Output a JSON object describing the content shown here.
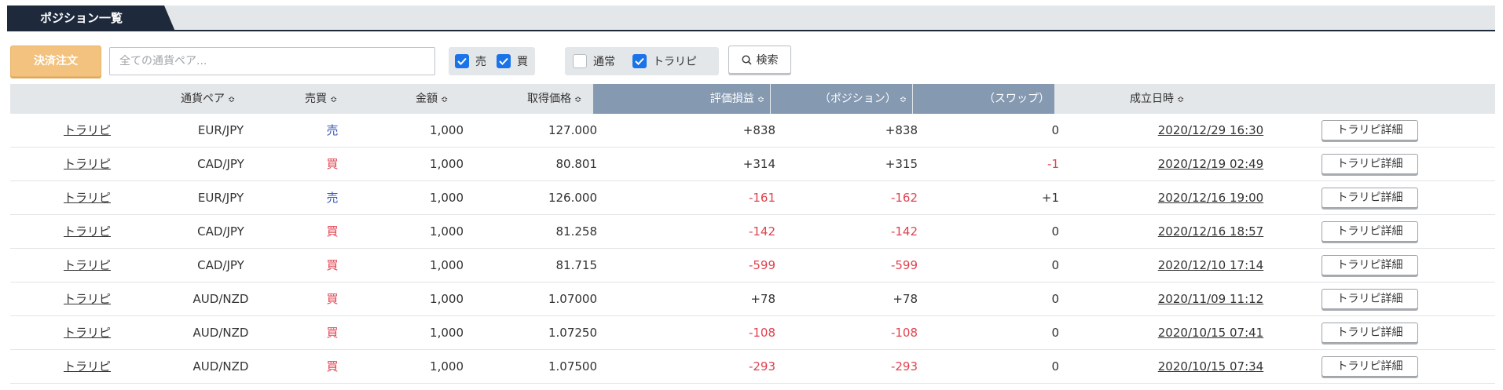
{
  "tab": {
    "title": "ポジション一覧"
  },
  "toolbar": {
    "settle_label": "決済注文",
    "search_placeholder": "全ての通貨ペア...",
    "sell_label": "売",
    "buy_label": "買",
    "normal_label": "通常",
    "trarepi_label": "トラリピ",
    "search_label": "検索",
    "sell_checked": true,
    "buy_checked": true,
    "normal_checked": false,
    "trarepi_checked": true
  },
  "columns": {
    "pair": "通貨ペア",
    "side": "売買",
    "amount": "金額",
    "price": "取得価格",
    "pnl": "評価損益",
    "position": "（ポジション）",
    "swap": "（スワップ）",
    "date": "成立日時"
  },
  "rows": [
    {
      "type": "トラリピ",
      "pair": "EUR/JPY",
      "side": "売",
      "side_kind": "sell",
      "amount": "1,000",
      "price": "127.000",
      "pnl": "+838",
      "position": "+838",
      "swap": "0",
      "date": "2020/12/29 16:30",
      "detail": "トラリピ詳細"
    },
    {
      "type": "トラリピ",
      "pair": "CAD/JPY",
      "side": "買",
      "side_kind": "buy",
      "amount": "1,000",
      "price": "80.801",
      "pnl": "+314",
      "position": "+315",
      "swap": "-1",
      "date": "2020/12/19 02:49",
      "detail": "トラリピ詳細"
    },
    {
      "type": "トラリピ",
      "pair": "EUR/JPY",
      "side": "売",
      "side_kind": "sell",
      "amount": "1,000",
      "price": "126.000",
      "pnl": "-161",
      "position": "-162",
      "swap": "+1",
      "date": "2020/12/16 19:00",
      "detail": "トラリピ詳細"
    },
    {
      "type": "トラリピ",
      "pair": "CAD/JPY",
      "side": "買",
      "side_kind": "buy",
      "amount": "1,000",
      "price": "81.258",
      "pnl": "-142",
      "position": "-142",
      "swap": "0",
      "date": "2020/12/16 18:57",
      "detail": "トラリピ詳細"
    },
    {
      "type": "トラリピ",
      "pair": "CAD/JPY",
      "side": "買",
      "side_kind": "buy",
      "amount": "1,000",
      "price": "81.715",
      "pnl": "-599",
      "position": "-599",
      "swap": "0",
      "date": "2020/12/10 17:14",
      "detail": "トラリピ詳細"
    },
    {
      "type": "トラリピ",
      "pair": "AUD/NZD",
      "side": "買",
      "side_kind": "buy",
      "amount": "1,000",
      "price": "1.07000",
      "pnl": "+78",
      "position": "+78",
      "swap": "0",
      "date": "2020/11/09 11:12",
      "detail": "トラリピ詳細"
    },
    {
      "type": "トラリピ",
      "pair": "AUD/NZD",
      "side": "買",
      "side_kind": "buy",
      "amount": "1,000",
      "price": "1.07250",
      "pnl": "-108",
      "position": "-108",
      "swap": "0",
      "date": "2020/10/15 07:41",
      "detail": "トラリピ詳細"
    },
    {
      "type": "トラリピ",
      "pair": "AUD/NZD",
      "side": "買",
      "side_kind": "buy",
      "amount": "1,000",
      "price": "1.07500",
      "pnl": "-293",
      "position": "-293",
      "swap": "0",
      "date": "2020/10/15 07:34",
      "detail": "トラリピ詳細"
    }
  ],
  "colors": {
    "tab_bg": "#1e2a3c",
    "settle_button": "#f2c27e",
    "checkbox_on": "#1a73e8",
    "header_highlight": "#8599b1",
    "sell": "#3a5bb5",
    "negative": "#e0424f"
  },
  "icons": {
    "search": "magnifier-icon",
    "sort": "sort-updown-icon",
    "check": "checkmark-icon"
  }
}
